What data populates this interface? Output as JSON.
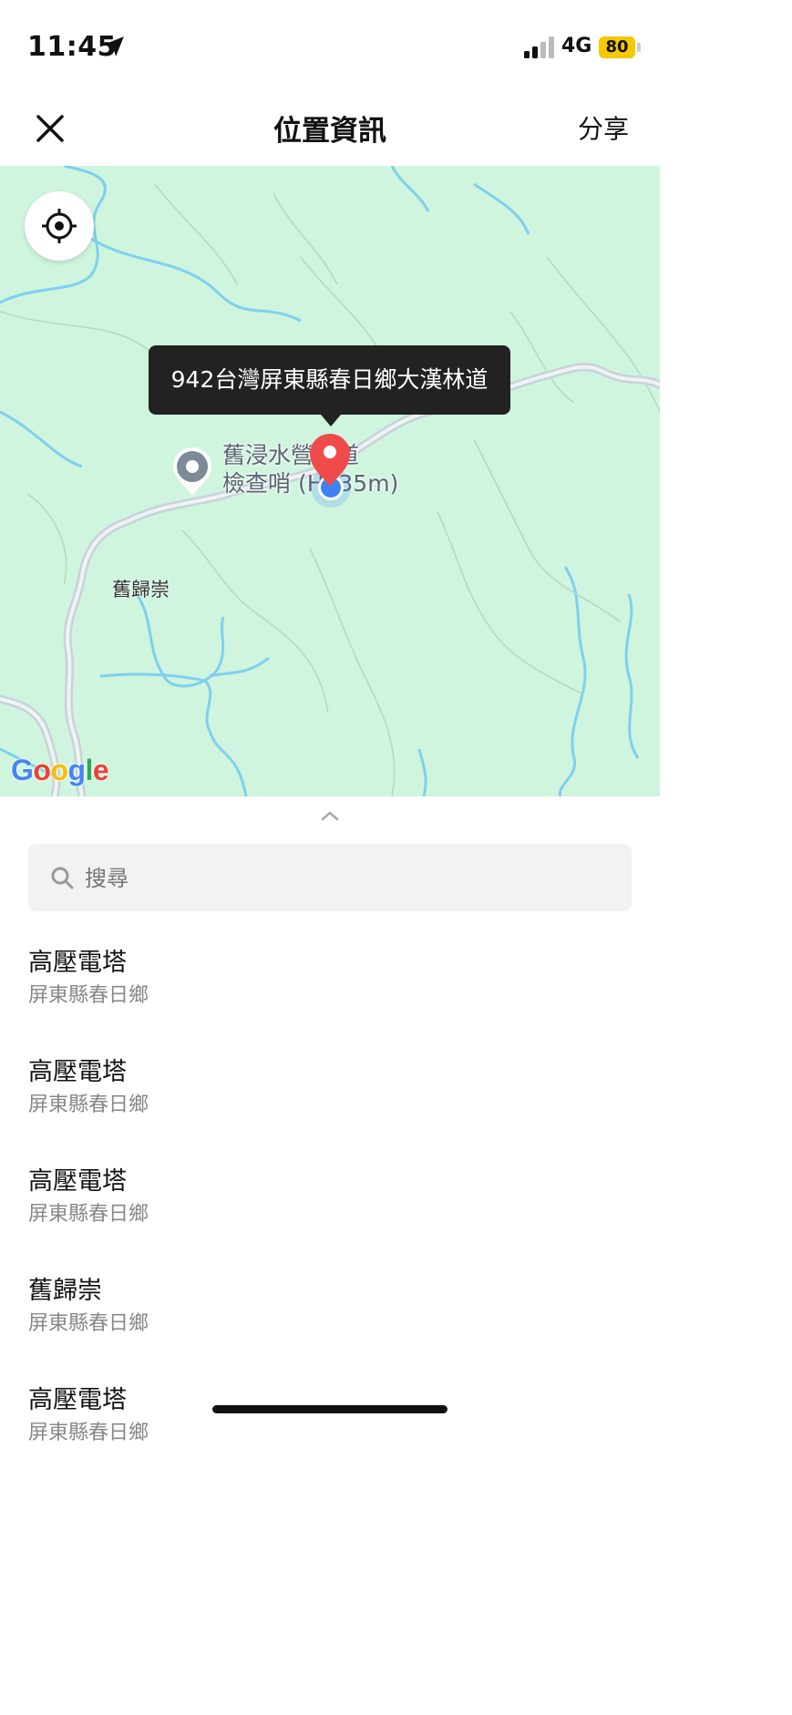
{
  "status": {
    "time": "11:45",
    "network": "4G",
    "battery": "80",
    "battery_color": "#f5c800"
  },
  "header": {
    "title": "位置資訊",
    "share_label": "分享"
  },
  "map": {
    "background": "#cff5df",
    "callout": "942台灣屏東縣春日鄉大漢林道",
    "poi_line1": "舊浸水營古道",
    "poi_line2": "檢查哨 (H835m)",
    "place_label": "舊歸崇",
    "pin_color": "#f04b4b",
    "my_location_color": "#3b82f6"
  },
  "search": {
    "placeholder": "搜尋"
  },
  "list": [
    {
      "name": "高壓電塔",
      "sub": "屏東縣春日鄉"
    },
    {
      "name": "高壓電塔",
      "sub": "屏東縣春日鄉"
    },
    {
      "name": "高壓電塔",
      "sub": "屏東縣春日鄉"
    },
    {
      "name": "舊歸崇",
      "sub": "屏東縣春日鄉"
    },
    {
      "name": "高壓電塔",
      "sub": "屏東縣春日鄉"
    }
  ]
}
